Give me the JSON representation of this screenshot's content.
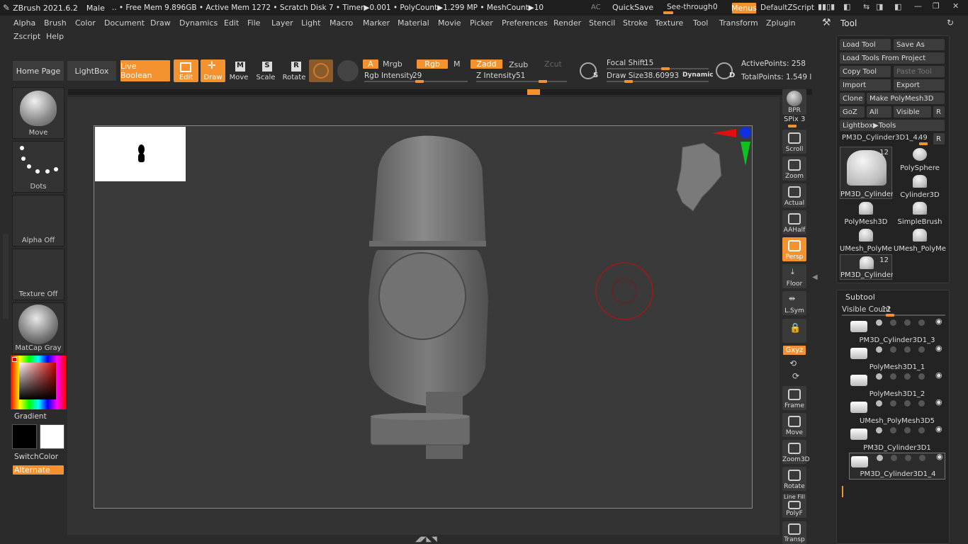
{
  "titlebar": {
    "app": "ZBrush 2021.6.2",
    "model": "Male",
    "stats": ".. • Free Mem 9.896GB • Active Mem 1272 • Scratch Disk 7 •  Timer▶0.001 • PolyCount▶1.299 MP  • MeshCount▶10",
    "ac": "AC",
    "quicksave": "QuickSave",
    "seethrough_label": "See-through",
    "seethrough_value": "0",
    "menus": "Menus",
    "script": "DefaultZScript"
  },
  "menus": [
    "Alpha",
    "Brush",
    "Color",
    "Document",
    "Draw",
    "Dynamics",
    "Edit",
    "File",
    "Layer",
    "Light",
    "Macro",
    "Marker",
    "Material",
    "Movie",
    "Picker",
    "Preferences",
    "Render",
    "Stencil",
    "Stroke",
    "Texture",
    "Tool",
    "Transform",
    "Zplugin"
  ],
  "menus2": [
    "Zscript",
    "Help"
  ],
  "toolbar": {
    "home": "Home Page",
    "lightbox": "LightBox",
    "live_boolean": "Live Boolean",
    "edit": "Edit",
    "draw": "Draw",
    "move": "Move",
    "scale": "Scale",
    "rotate": "Rotate",
    "a": "A",
    "mrgb": "Mrgb",
    "rgb": "Rgb",
    "m": "M",
    "zadd": "Zadd",
    "zsub": "Zsub",
    "zcut": "Zcut",
    "rgb_intensity_label": "Rgb Intensity",
    "rgb_intensity": "29",
    "z_intensity_label": "Z Intensity",
    "z_intensity": "51",
    "focal_shift_label": "Focal Shift",
    "focal_shift": "15",
    "draw_size_label": "Draw Size",
    "draw_size": "38.60993",
    "dynamic": "Dynamic",
    "active_points": "ActivePoints: 258",
    "total_points": "TotalPoints: 1.549 l"
  },
  "left_shelf": {
    "brush": "Move",
    "stroke": "Dots",
    "alpha": "Alpha Off",
    "texture": "Texture Off",
    "material": "MatCap Gray",
    "gradient": "Gradient",
    "switchcolor": "SwitchColor",
    "alternate": "Alternate"
  },
  "right_shelf": {
    "bpr": "BPR",
    "spix": "SPix 3",
    "scroll": "Scroll",
    "zoom": "Zoom",
    "actual": "Actual",
    "aahalf": "AAHalf",
    "persp": "Persp",
    "floor": "Floor",
    "lsym": "L.Sym",
    "xyz": "Gxyz",
    "frame": "Frame",
    "move": "Move",
    "zoom3d": "Zoom3D",
    "rotate": "Rotate",
    "linefill": "Line Fill",
    "polyf": "PolyF",
    "transp": "Transp"
  },
  "tool_panel": {
    "title": "Tool",
    "load_tool": "Load Tool",
    "save_as": "Save As",
    "load_from_project": "Load Tools From Project",
    "copy_tool": "Copy Tool",
    "paste_tool": "Paste Tool",
    "import": "Import",
    "export": "Export",
    "clone": "Clone",
    "make_polymesh": "Make PolyMesh3D",
    "goz": "GoZ",
    "all": "All",
    "visible": "Visible",
    "r": "R",
    "lightbox_tools": "Lightbox▶Tools",
    "current_tool": "PM3D_Cylinder3D1_4.",
    "current_value": "49",
    "tools": [
      {
        "name": "PM3D_Cylinder",
        "badge": "12"
      },
      {
        "name": "PolySphere",
        "badge": ""
      },
      {
        "name": "Cylinder3D",
        "badge": ""
      },
      {
        "name": "PolyMesh3D",
        "badge": ""
      },
      {
        "name": "SimpleBrush",
        "badge": ""
      },
      {
        "name": "UMesh_PolyMe",
        "badge": ""
      },
      {
        "name": "UMesh_PolyMe",
        "badge": ""
      },
      {
        "name": "PM3D_Cylinder",
        "badge": "12"
      }
    ]
  },
  "subtool": {
    "title": "Subtool",
    "visible_count_label": "Visible Count",
    "visible_count": "12",
    "items": [
      {
        "name": "PM3D_Cylinder3D1_3"
      },
      {
        "name": "PolyMesh3D1_1"
      },
      {
        "name": "PolyMesh3D1_2"
      },
      {
        "name": "UMesh_PolyMesh3D5"
      },
      {
        "name": "PM3D_Cylinder3D1"
      },
      {
        "name": "PM3D_Cylinder3D1_4"
      }
    ]
  },
  "colors": {
    "accent": "#f3922e",
    "bg": "#2b2b2b",
    "canvas": "#3a3a3a"
  }
}
